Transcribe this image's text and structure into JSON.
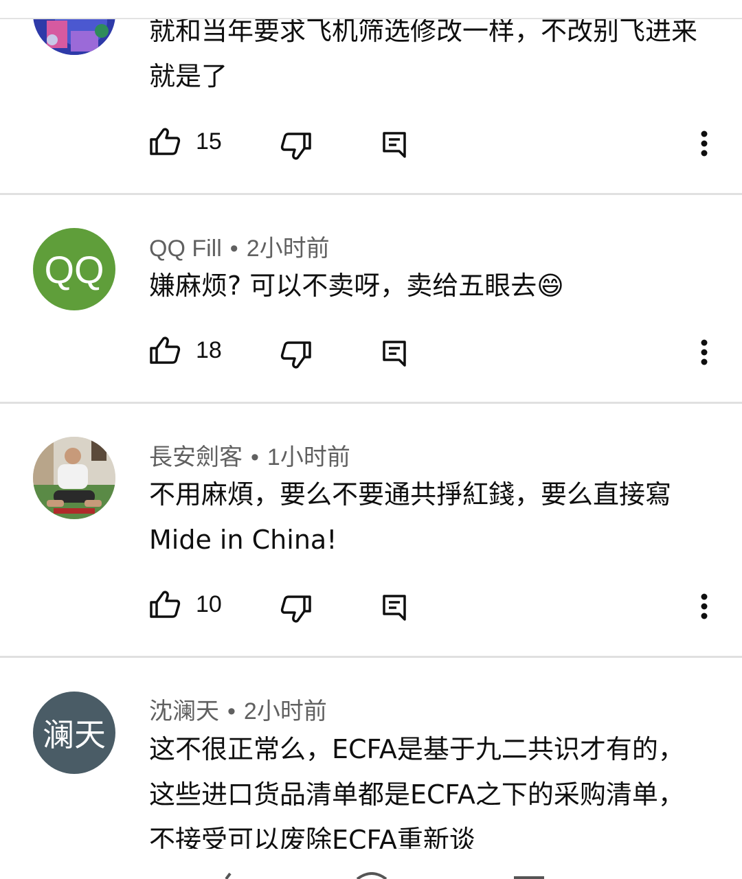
{
  "comments": [
    {
      "author": "",
      "time": "",
      "text": "就和当年要求飞机筛选修改一样，不改别飞进来就是了",
      "likes": "15"
    },
    {
      "author": "QQ Fill",
      "time": "2小时前",
      "avatar_text": "QQ",
      "avatar_color": "#5f9e3a",
      "text": "嫌麻烦? 可以不卖呀，卖给五眼去😄",
      "likes": "18"
    },
    {
      "author": "長安劍客",
      "time": "1小时前",
      "text": "不用麻煩，要么不要通共掙紅錢，要么直接寫Mide in China!",
      "likes": "10"
    },
    {
      "author": "沈澜天",
      "time": "2小时前",
      "avatar_text": "澜天",
      "avatar_color": "#4a5c66",
      "text": "这不很正常么，ECFA是基于九二共识才有的，这些进口货品清单都是ECFA之下的采购清单，不接受可以废除ECFA重新谈"
    }
  ],
  "separator": "•",
  "icons": {
    "like": "thumb-up-outline-icon",
    "dislike": "thumb-down-outline-icon",
    "reply": "reply-comment-icon",
    "more": "more-vertical-icon"
  }
}
